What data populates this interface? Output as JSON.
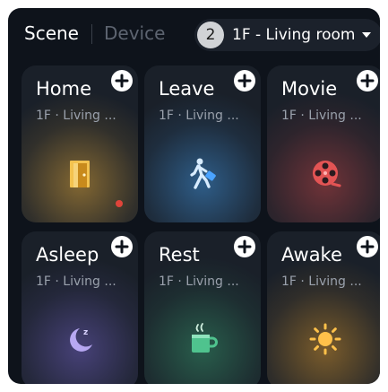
{
  "header": {
    "tabs": [
      {
        "label": "Scene",
        "active": true
      },
      {
        "label": "Device",
        "active": false
      }
    ],
    "room_selector": {
      "badge": "2",
      "label": "1F - Living room",
      "icon": "caret-down-icon"
    }
  },
  "scenes": [
    {
      "title": "Home",
      "subtitle": "1F · Living ...",
      "icon": "door-icon",
      "accent": "#d9a23a",
      "has_alert": true
    },
    {
      "title": "Leave",
      "subtitle": "1F · Living ...",
      "icon": "walking-person-icon",
      "accent": "#3f8fd6",
      "has_alert": false
    },
    {
      "title": "Movie",
      "subtitle": "1F · Living ...",
      "icon": "film-reel-icon",
      "accent": "#d94a4a",
      "has_alert": false
    },
    {
      "title": "Asleep",
      "subtitle": "1F · Living ...",
      "icon": "moon-icon",
      "accent": "#7d6ad8",
      "has_alert": false
    },
    {
      "title": "Rest",
      "subtitle": "1F · Living ...",
      "icon": "coffee-cup-icon",
      "accent": "#3aa876",
      "has_alert": false
    },
    {
      "title": "Awake",
      "subtitle": "1F · Living ...",
      "icon": "sun-icon",
      "accent": "#f0a52e",
      "has_alert": false
    }
  ],
  "colors": {
    "background": "#0e131b",
    "card": "#1a2029",
    "alert_dot": "#e0443a"
  }
}
